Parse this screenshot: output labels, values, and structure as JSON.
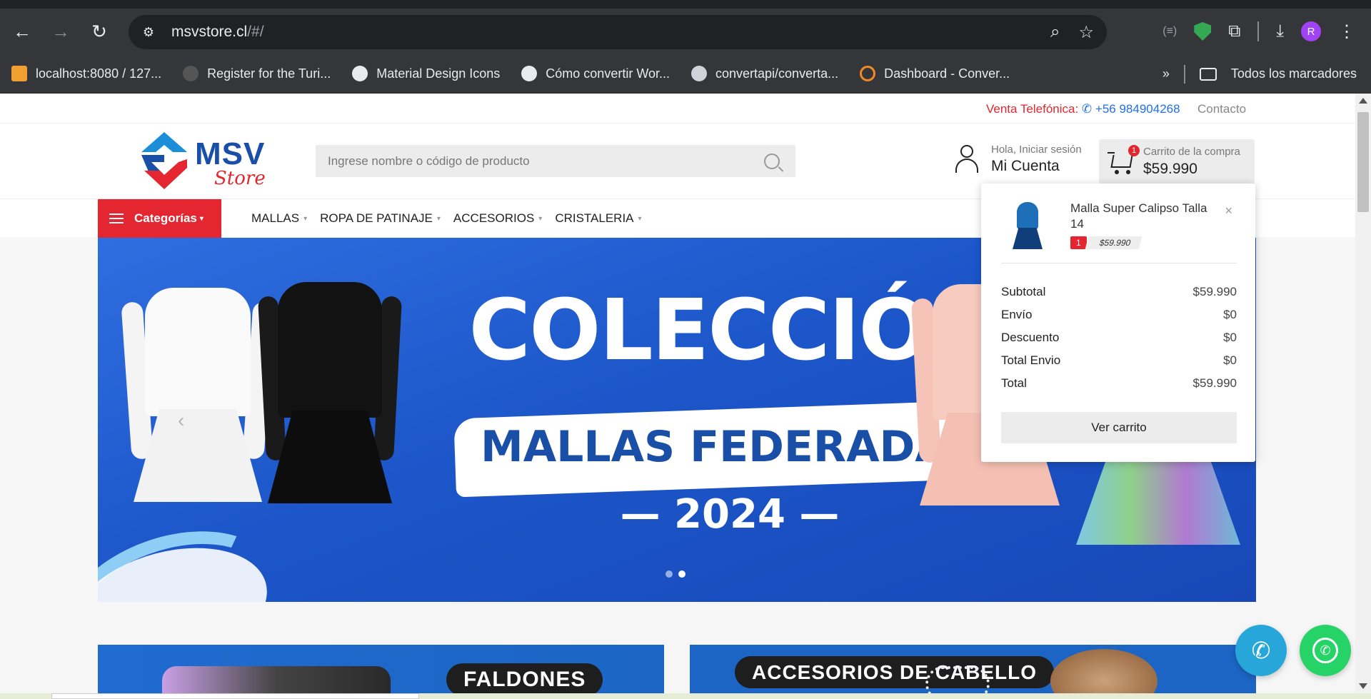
{
  "browser": {
    "url_host": "msvstore.cl",
    "url_path": "/#/",
    "bookmarks": [
      {
        "label": "localhost:8080 / 127...",
        "icon": "phpmyadmin-icon",
        "color": "#f0a030"
      },
      {
        "label": "Register for the Turi...",
        "icon": "github-icon",
        "color": "#555555"
      },
      {
        "label": "Material Design Icons",
        "icon": "globe-icon",
        "color": "#e8eaed"
      },
      {
        "label": "Cómo convertir Wor...",
        "icon": "globe-icon",
        "color": "#e8eaed"
      },
      {
        "label": "convertapi/converta...",
        "icon": "bug-icon",
        "color": "#e8eaed"
      },
      {
        "label": "Dashboard - Conver...",
        "icon": "convertapi-icon",
        "color": "#f08a24"
      }
    ],
    "all_bookmarks_label": "Todos los marcadores",
    "avatar_letter": "R"
  },
  "topbar": {
    "sales_label": "Venta Telefónica:",
    "phone": "+56 984904268",
    "contact": "Contacto"
  },
  "header": {
    "logo_main": "MSV",
    "logo_sub": "Store",
    "search_placeholder": "Ingrese nombre o código de producto",
    "account_greeting": "Hola, Iniciar sesión",
    "account_name": "Mi Cuenta",
    "cart_label": "Carrito de la compra",
    "cart_amount": "$59.990",
    "cart_count": "1"
  },
  "nav": {
    "categories": "Categorías",
    "items": [
      "MALLAS",
      "ROPA DE PATINAJE",
      "ACCESORIOS",
      "CRISTALERIA"
    ]
  },
  "banner": {
    "title": "COLECCIÓN",
    "subtitle": "MALLAS FEDERADAS",
    "year": "— 2024 —",
    "slides": 2,
    "active_slide": 2
  },
  "promos": [
    {
      "label": "FALDONES"
    },
    {
      "label": "ACCESORIOS DE CABELLO"
    }
  ],
  "cart_dropdown": {
    "item_name": "Malla Super Calipso Talla 14",
    "item_qty": "1",
    "item_price": "$59.990",
    "rows": [
      {
        "label": "Subtotal",
        "value": "$59.990"
      },
      {
        "label": "Envío",
        "value": "$0"
      },
      {
        "label": "Descuento",
        "value": "$0"
      },
      {
        "label": "Total Envio",
        "value": "$0"
      },
      {
        "label": "Total",
        "value": "$59.990"
      }
    ],
    "button": "Ver carrito"
  },
  "colors": {
    "brand_red": "#e3262f",
    "brand_blue": "#1a4fa8",
    "phone_fab": "#27a7d9",
    "whatsapp_fab": "#25d366"
  }
}
